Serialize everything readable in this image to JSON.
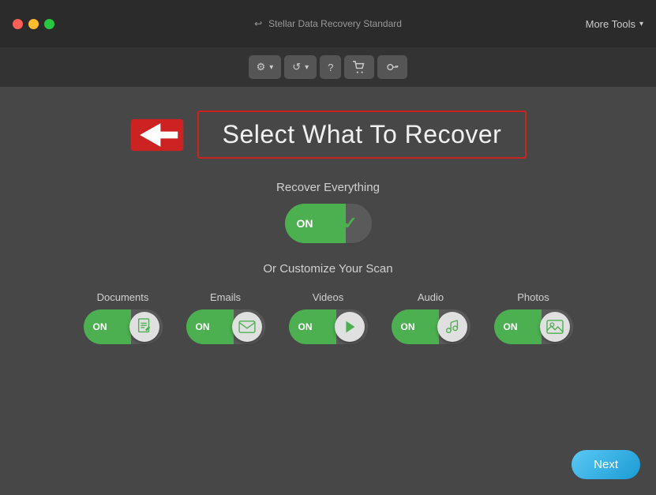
{
  "app": {
    "title": "Stellar Data Recovery Standard",
    "traffic_lights": [
      "red",
      "yellow",
      "green"
    ]
  },
  "toolbar": {
    "buttons": [
      {
        "label": "⚙",
        "has_arrow": true,
        "name": "settings-button"
      },
      {
        "label": "↺",
        "has_arrow": true,
        "name": "history-button"
      },
      {
        "label": "?",
        "has_arrow": false,
        "name": "help-button"
      },
      {
        "label": "🛒",
        "has_arrow": false,
        "name": "cart-button"
      },
      {
        "label": "🔑",
        "has_arrow": false,
        "name": "key-button"
      }
    ],
    "more_tools_label": "More Tools"
  },
  "main": {
    "page_title": "Select What To Recover",
    "recover_everything_label": "Recover Everything",
    "recover_toggle_state": "ON",
    "customize_label": "Or Customize Your Scan",
    "categories": [
      {
        "label": "Documents",
        "state": "ON",
        "icon": "📄"
      },
      {
        "label": "Emails",
        "state": "ON",
        "icon": "✉"
      },
      {
        "label": "Videos",
        "state": "ON",
        "icon": "▶"
      },
      {
        "label": "Audio",
        "state": "ON",
        "icon": "♪"
      },
      {
        "label": "Photos",
        "state": "ON",
        "icon": "🖼"
      }
    ],
    "next_button_label": "Next"
  }
}
